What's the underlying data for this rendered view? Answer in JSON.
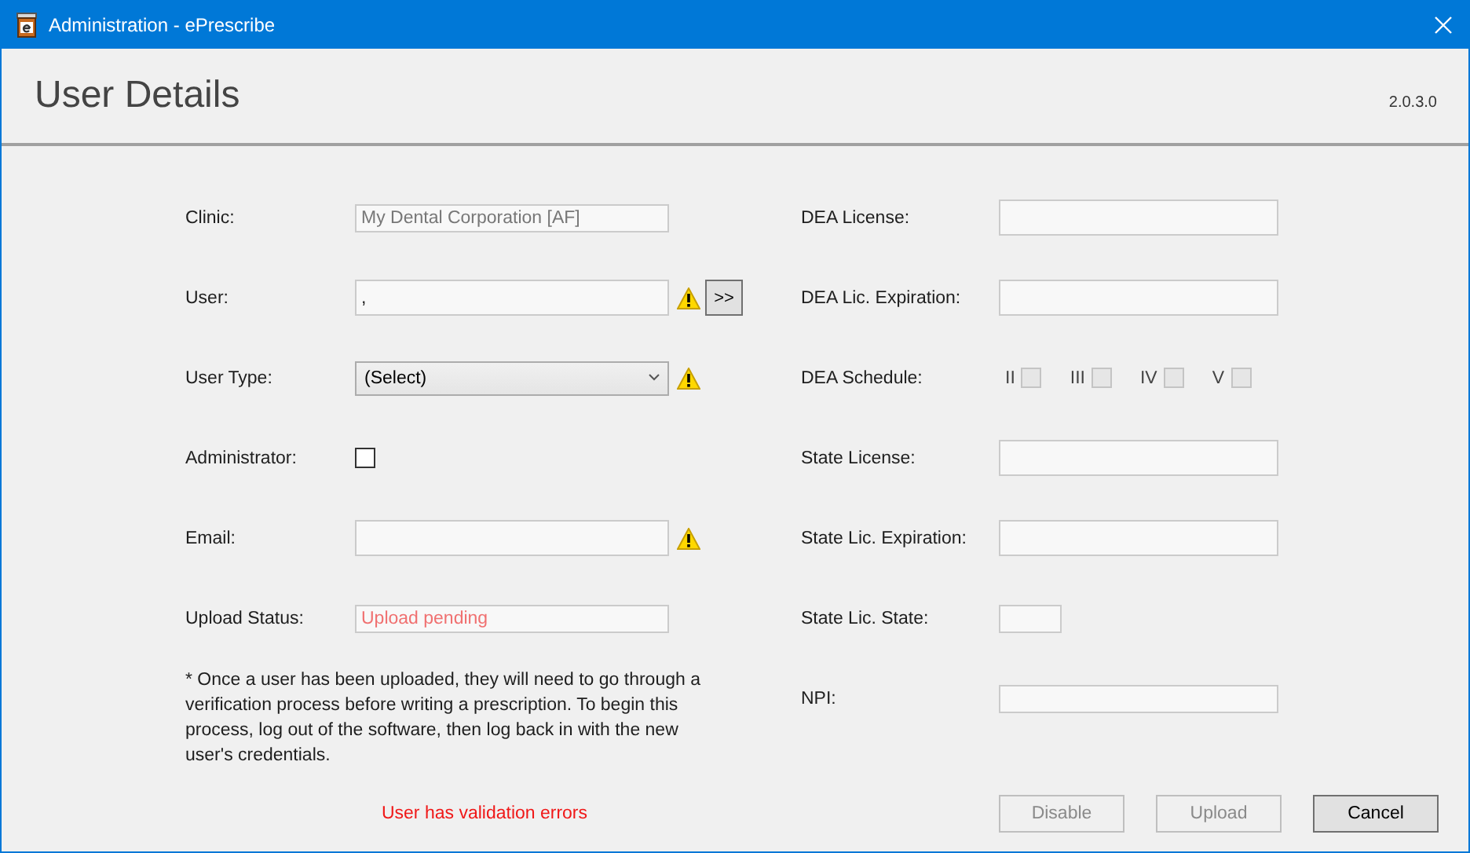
{
  "window": {
    "title": "Administration - ePrescribe"
  },
  "header": {
    "heading": "User Details",
    "version": "2.0.3.0"
  },
  "left_fields": [
    {
      "kind": "text",
      "label": "Clinic:",
      "value": "My Dental Corporation [AF]",
      "readonly": true,
      "warning": false
    },
    {
      "kind": "text",
      "label": "User:",
      "value": ",",
      "readonly": false,
      "warning": true,
      "lookup_button": ">>"
    },
    {
      "kind": "select",
      "label": "User Type:",
      "value": "(Select)",
      "warning": true
    },
    {
      "kind": "checkbox",
      "label": "Administrator:",
      "checked": false
    },
    {
      "kind": "text",
      "label": "Email:",
      "readonly": false,
      "warning": true
    },
    {
      "kind": "status",
      "label": "Upload Status:",
      "value": "Upload pending"
    }
  ],
  "note": "* Once a user has been uploaded, they will need to go through a verification process before writing a prescription. To begin this process, log out of the software, then log back in with the new user's credentials.",
  "right_fields": [
    {
      "kind": "text",
      "label": "DEA License:"
    },
    {
      "kind": "text",
      "label": "DEA Lic. Expiration:"
    },
    {
      "kind": "schedules",
      "label": "DEA Schedule:",
      "options": [
        {
          "label": "II",
          "checked": false
        },
        {
          "label": "III",
          "checked": false
        },
        {
          "label": "IV",
          "checked": false
        },
        {
          "label": "V",
          "checked": false
        }
      ]
    },
    {
      "kind": "text",
      "label": "State License:"
    },
    {
      "kind": "text",
      "label": "State Lic. Expiration:"
    },
    {
      "kind": "short",
      "label": "State Lic. State:"
    },
    {
      "kind": "text",
      "label": "NPI:"
    }
  ],
  "validation_message": "User has validation errors",
  "buttons": [
    {
      "label": "Disable",
      "disabled": true
    },
    {
      "label": "Upload",
      "disabled": true
    },
    {
      "label": "Cancel",
      "disabled": false
    }
  ]
}
